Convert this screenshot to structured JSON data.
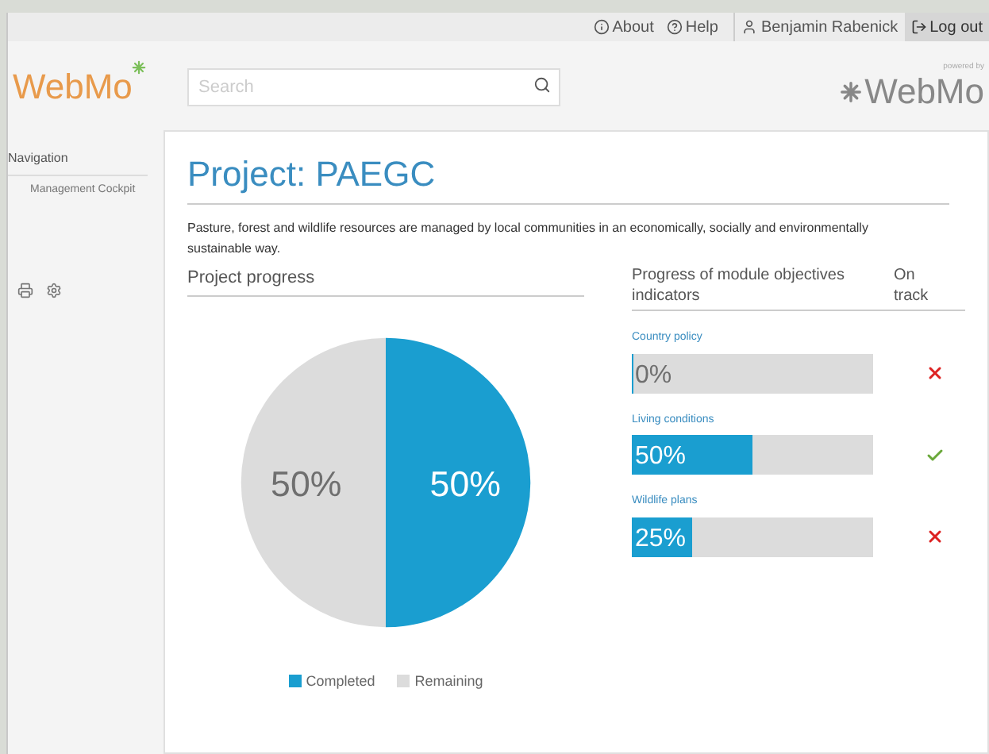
{
  "top_bar": {
    "links": [
      {
        "kind": "info",
        "label": "About"
      },
      {
        "kind": "help",
        "label": "Help"
      },
      {
        "kind": "user",
        "label": "Benjamin Rabenick"
      },
      {
        "kind": "logout",
        "label": "Log out"
      }
    ]
  },
  "header": {
    "logo": "WebMo",
    "search": {
      "placeholder": "Search"
    },
    "powered_by": "powered by",
    "brand": "WebMo"
  },
  "sidebar": {
    "title": "Navigation",
    "items": [
      {
        "label": "Management Cockpit"
      }
    ]
  },
  "project": {
    "title": "Project: PAEGC",
    "description": "Pasture, forest and wildlife resources are managed by local communities in an economically, socially and environmentally sustainable way.",
    "progress": {
      "chart_data": {
        "type": "pie",
        "title": "Project progress",
        "categories": [
          "Completed",
          "Remaining"
        ],
        "values": [
          50,
          50
        ],
        "data_labels": true,
        "value_labels": [
          "50%",
          "50%"
        ],
        "legend": "bottom"
      }
    },
    "indicators": {
      "heading": "Progress of module objectives indicators",
      "status_heading": "On track",
      "items": [
        {
          "name": "Country policy",
          "level": 0,
          "reading": "0%",
          "on_track": false
        },
        {
          "name": "Living conditions",
          "level": 0.5,
          "reading": "50%",
          "on_track": true
        },
        {
          "name": "Wildlife plans",
          "level": 0.25,
          "reading": "25%",
          "on_track": false
        }
      ]
    }
  }
}
